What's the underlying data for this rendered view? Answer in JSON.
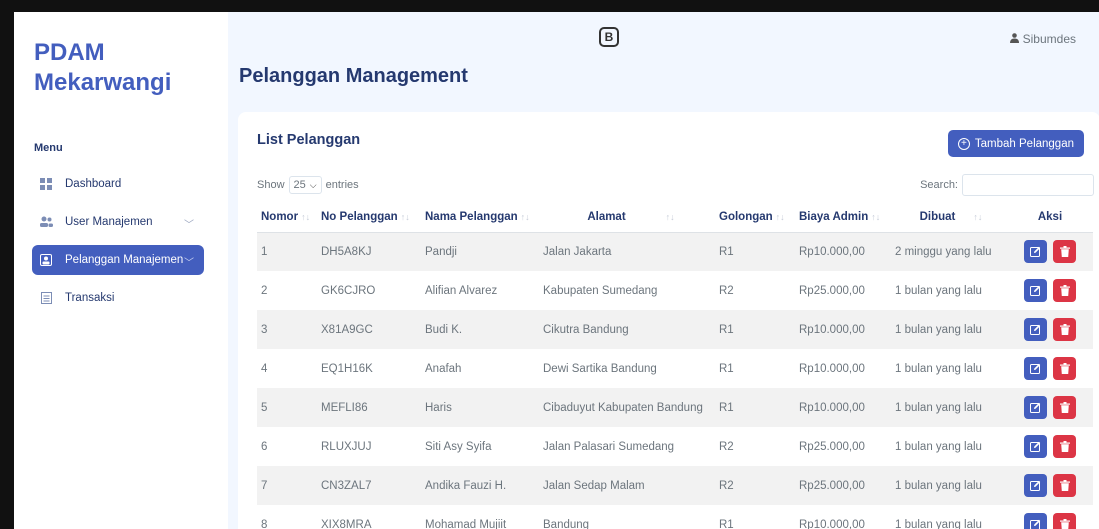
{
  "sidebar": {
    "brand": "PDAM\nMekarwangi",
    "brand_line1": "PDAM",
    "brand_line2": "Mekarwangi",
    "menu_title": "Menu",
    "items": [
      {
        "label": "Dashboard",
        "icon": "grid-icon",
        "active": false
      },
      {
        "label": "User Manajemen",
        "icon": "users-icon",
        "active": false,
        "has_chevron": true
      },
      {
        "label": "Pelanggan Manajemen",
        "icon": "person-card-icon",
        "active": true,
        "has_chevron": true
      },
      {
        "label": "Transaksi",
        "icon": "receipt-icon",
        "active": false
      }
    ]
  },
  "topbar": {
    "logo_letter": "B",
    "user_name": "Sibumdes"
  },
  "page": {
    "title": "Pelanggan Management"
  },
  "card": {
    "title": "List Pelanggan",
    "add_button": "Tambah Pelanggan",
    "show_label": "Show",
    "entries_value": "25",
    "entries_label": "entries",
    "search_label": "Search:",
    "search_value": ""
  },
  "table": {
    "headers": [
      "Nomor",
      "No Pelanggan",
      "Nama Pelanggan",
      "Alamat",
      "Golongan",
      "Biaya Admin",
      "Dibuat",
      "Aksi"
    ],
    "rows": [
      [
        "1",
        "DH5A8KJ",
        "Pandji",
        "Jalan Jakarta",
        "R1",
        "Rp10.000,00",
        "2 minggu yang lalu"
      ],
      [
        "2",
        "GK6CJRO",
        "Alifian Alvarez",
        "Kabupaten Sumedang",
        "R2",
        "Rp25.000,00",
        "1 bulan yang lalu"
      ],
      [
        "3",
        "X81A9GC",
        "Budi K.",
        "Cikutra Bandung",
        "R1",
        "Rp10.000,00",
        "1 bulan yang lalu"
      ],
      [
        "4",
        "EQ1H16K",
        "Anafah",
        "Dewi Sartika Bandung",
        "R1",
        "Rp10.000,00",
        "1 bulan yang lalu"
      ],
      [
        "5",
        "MEFLI86",
        "Haris",
        "Cibaduyut Kabupaten Bandung",
        "R1",
        "Rp10.000,00",
        "1 bulan yang lalu"
      ],
      [
        "6",
        "RLUXJUJ",
        "Siti Asy Syifa",
        "Jalan Palasari Sumedang",
        "R2",
        "Rp25.000,00",
        "1 bulan yang lalu"
      ],
      [
        "7",
        "CN3ZAL7",
        "Andika Fauzi H.",
        "Jalan Sedap Malam",
        "R2",
        "Rp25.000,00",
        "1 bulan yang lalu"
      ],
      [
        "8",
        "XIX8MRA",
        "Mohamad Mujiit",
        "Bandung",
        "R1",
        "Rp10.000,00",
        "1 bulan yang lalu"
      ]
    ]
  },
  "colors": {
    "primary": "#435ebe",
    "danger": "#dc3545",
    "background": "#f2f7ff",
    "heading": "#25396f"
  }
}
